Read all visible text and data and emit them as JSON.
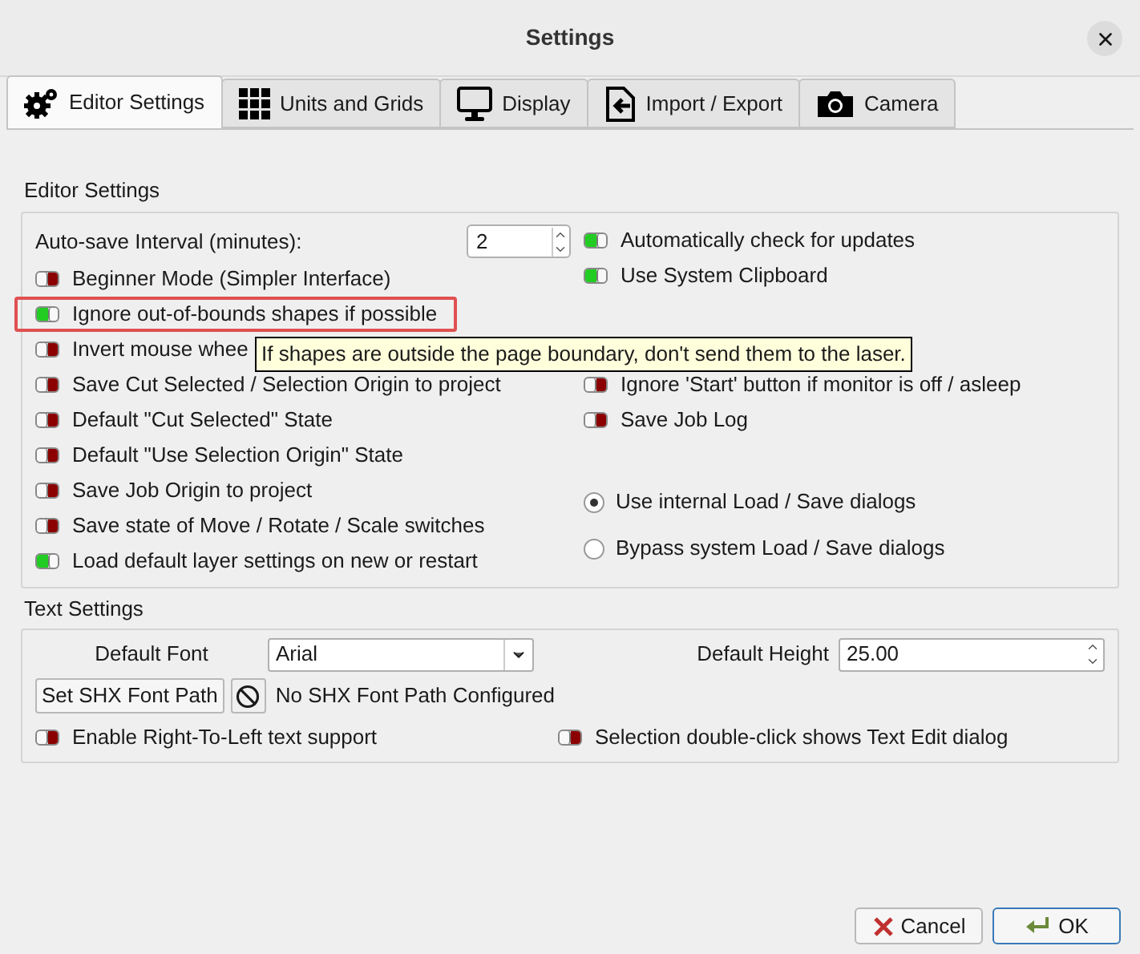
{
  "window": {
    "title": "Settings"
  },
  "tabs": [
    {
      "label": "Editor Settings",
      "selected": true
    },
    {
      "label": "Units and Grids",
      "selected": false
    },
    {
      "label": "Display",
      "selected": false
    },
    {
      "label": "Import / Export",
      "selected": false
    },
    {
      "label": "Camera",
      "selected": false
    }
  ],
  "editor_settings": {
    "title": "Editor Settings",
    "left": [
      {
        "kind": "spin",
        "label": "Auto-save Interval (minutes):",
        "value": "2"
      },
      {
        "kind": "toggle",
        "label": "Beginner Mode (Simpler Interface)",
        "on": false,
        "highlighted": false
      },
      {
        "kind": "toggle",
        "label": "Ignore out-of-bounds shapes if possible",
        "on": true,
        "highlighted": true
      },
      {
        "kind": "toggle",
        "label": "Invert mouse whee",
        "on": false,
        "highlighted": false
      },
      {
        "kind": "toggle",
        "label": "Save Cut Selected / Selection Origin to project",
        "on": false,
        "highlighted": false
      },
      {
        "kind": "toggle",
        "label": "Default \"Cut Selected\" State",
        "on": false,
        "highlighted": false
      },
      {
        "kind": "toggle",
        "label": "Default \"Use Selection Origin\" State",
        "on": false,
        "highlighted": false
      },
      {
        "kind": "toggle",
        "label": "Save Job Origin to project",
        "on": false,
        "highlighted": false
      },
      {
        "kind": "toggle",
        "label": "Save state of Move / Rotate / Scale switches",
        "on": false,
        "highlighted": false
      },
      {
        "kind": "toggle",
        "label": "Load default layer settings on new or restart",
        "on": true,
        "highlighted": false
      }
    ],
    "right_top": [
      {
        "label": "Automatically check for updates",
        "on": true
      },
      {
        "label": "Use System Clipboard",
        "on": true
      }
    ],
    "right_middle": [
      {
        "label": "Ignore 'Start' button if monitor is off / asleep",
        "on": false
      },
      {
        "label": "Save Job Log",
        "on": false
      }
    ],
    "radios": [
      {
        "label": "Use internal Load / Save dialogs",
        "selected": true
      },
      {
        "label": "Bypass system Load / Save dialogs",
        "selected": false
      }
    ]
  },
  "tooltip": "If shapes are outside the page boundary, don't send them to the laser.",
  "text_settings": {
    "title": "Text Settings",
    "font_label": "Default Font",
    "font_value": "Arial",
    "height_label": "Default Height",
    "height_value": "25.00",
    "shx_button": "Set SHX Font Path",
    "shx_status": "No SHX Font Path Configured",
    "toggles": [
      {
        "label": "Enable Right-To-Left text support",
        "on": false
      },
      {
        "label": "Selection double-click shows Text Edit dialog",
        "on": false
      }
    ]
  },
  "buttons": [
    {
      "label": "Cancel",
      "kind": "cancel",
      "default": false
    },
    {
      "label": "OK",
      "kind": "ok",
      "default": true
    }
  ]
}
